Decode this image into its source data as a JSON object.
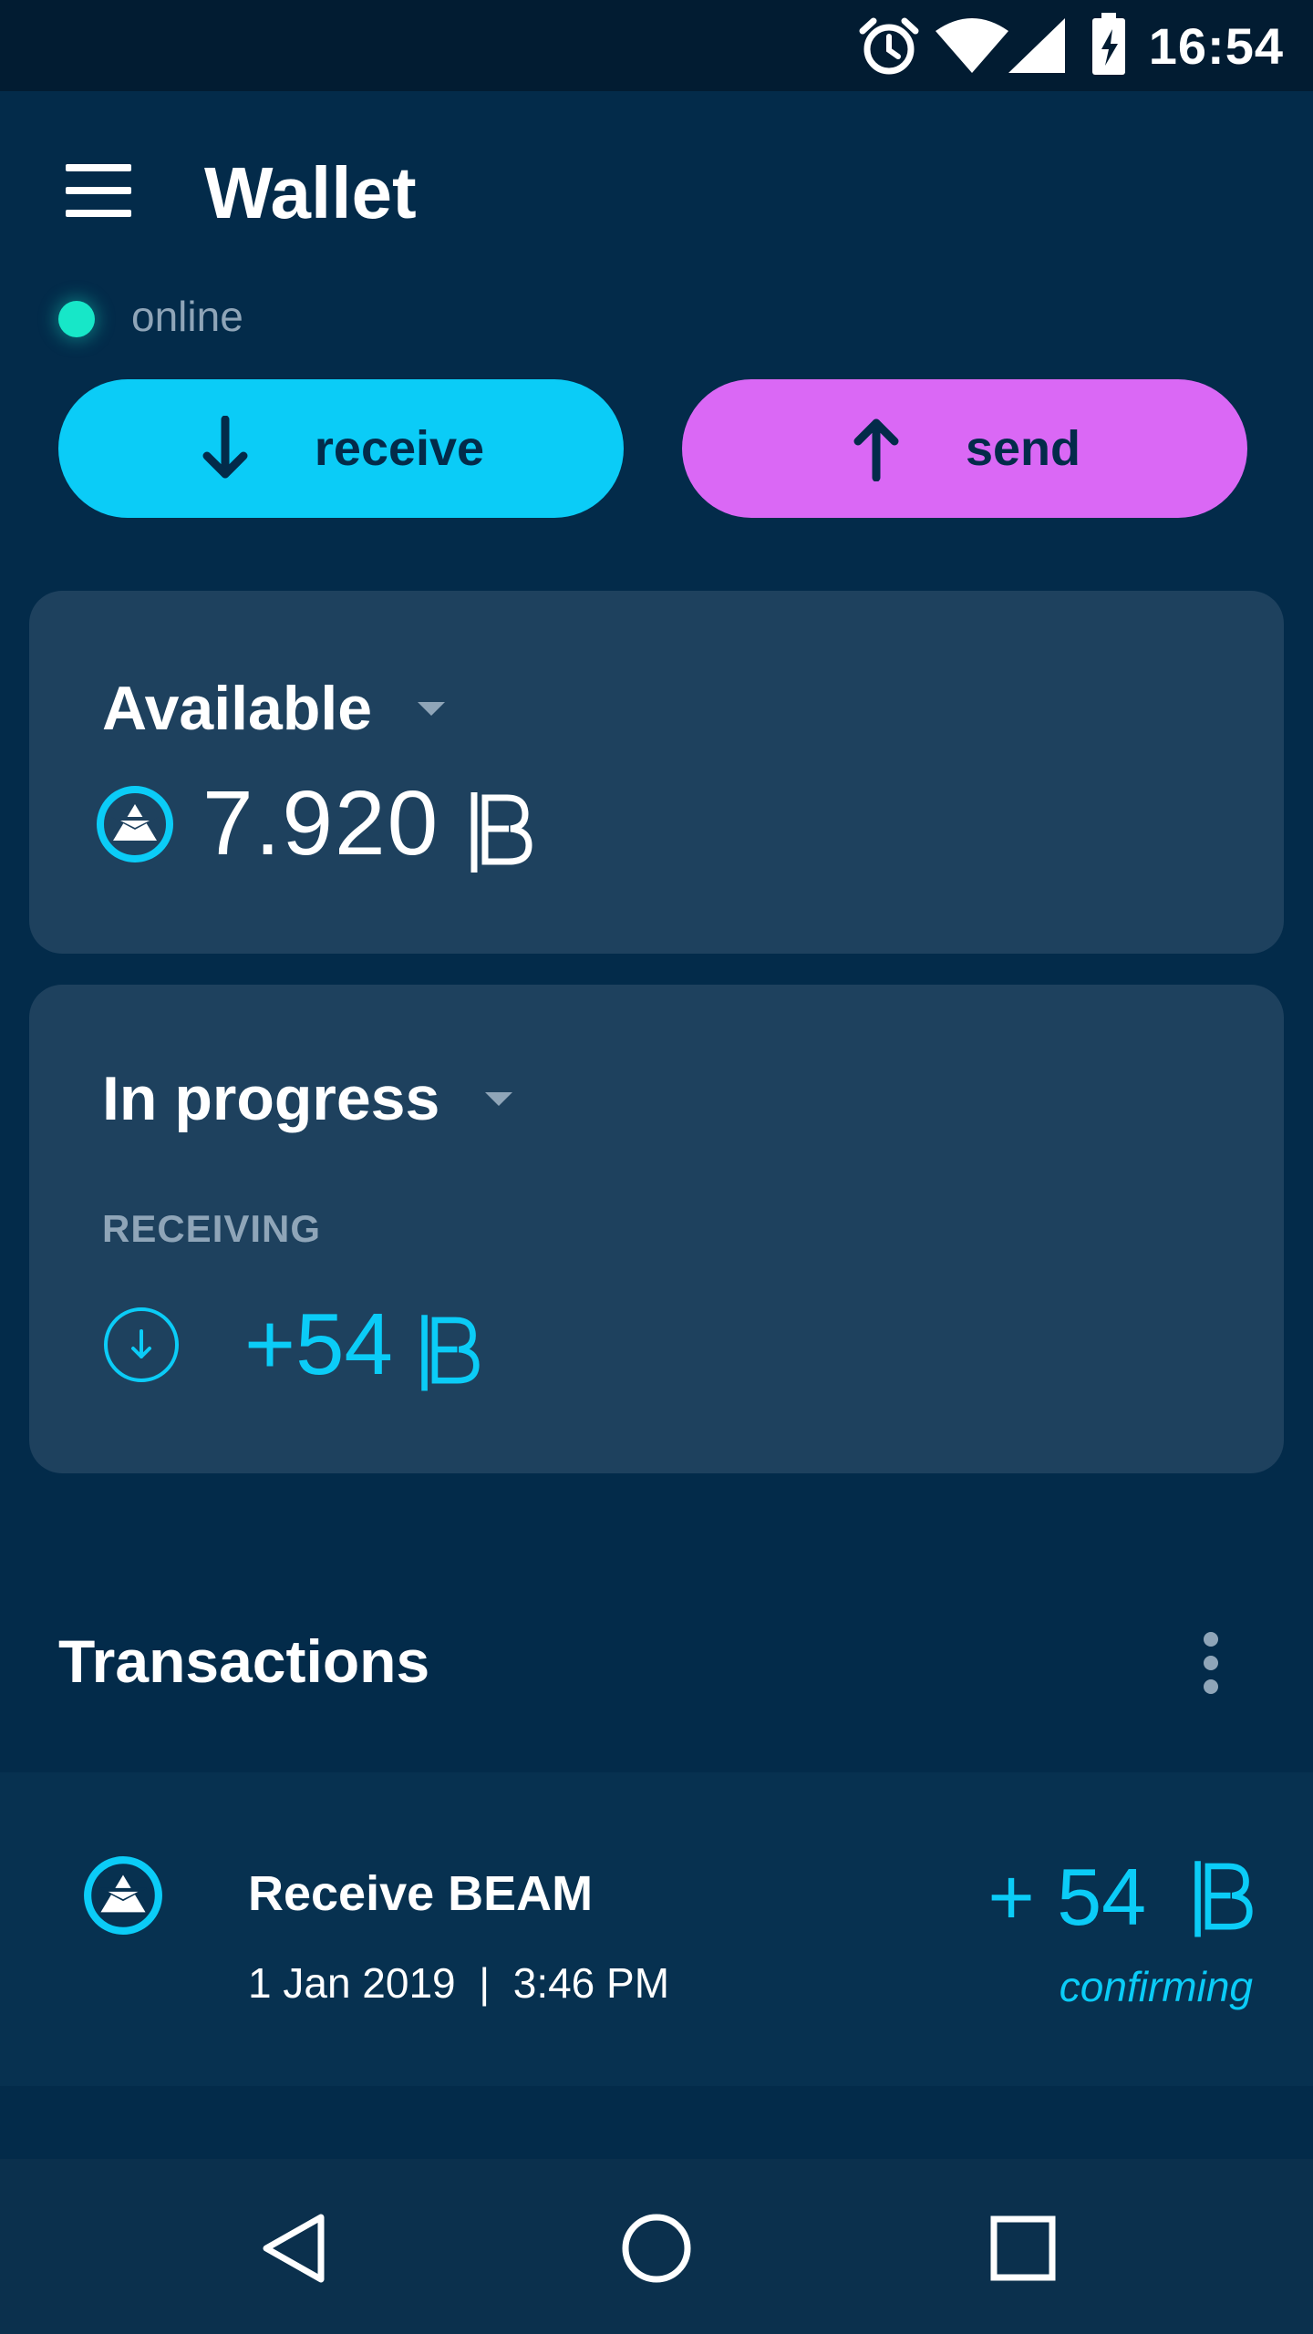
{
  "status_bar": {
    "time": "16:54",
    "icons": [
      "alarm-icon",
      "wifi-icon",
      "signal-icon",
      "battery-charging-icon"
    ]
  },
  "app_bar": {
    "title": "Wallet",
    "menu_icon": "hamburger-menu-icon"
  },
  "connection": {
    "status": "online",
    "color": "#17e7c8"
  },
  "actions": {
    "receive": {
      "label": "receive",
      "icon": "arrow-down-icon",
      "color": "#0bccf7"
    },
    "send": {
      "label": "send",
      "icon": "arrow-up-icon",
      "color": "#da68f5"
    }
  },
  "available": {
    "title": "Available",
    "amount": "7.920",
    "currency_icon": "beam-currency-icon"
  },
  "in_progress": {
    "title": "In progress",
    "receiving_label": "RECEIVING",
    "receiving_amount": "+54"
  },
  "transactions": {
    "title": "Transactions",
    "items": [
      {
        "title": "Receive BEAM",
        "date": "1 Jan 2019",
        "separator": "|",
        "time": "3:46 PM",
        "amount": "+ 54",
        "status": "confirming"
      }
    ]
  },
  "navigation": {
    "buttons": [
      "back-icon",
      "home-icon",
      "recents-icon"
    ]
  },
  "colors": {
    "background": "#032b4a",
    "card": "#1e415e",
    "accent_cyan": "#0bccf7",
    "accent_purple": "#da68f5",
    "muted_text": "#8fa5b8"
  }
}
